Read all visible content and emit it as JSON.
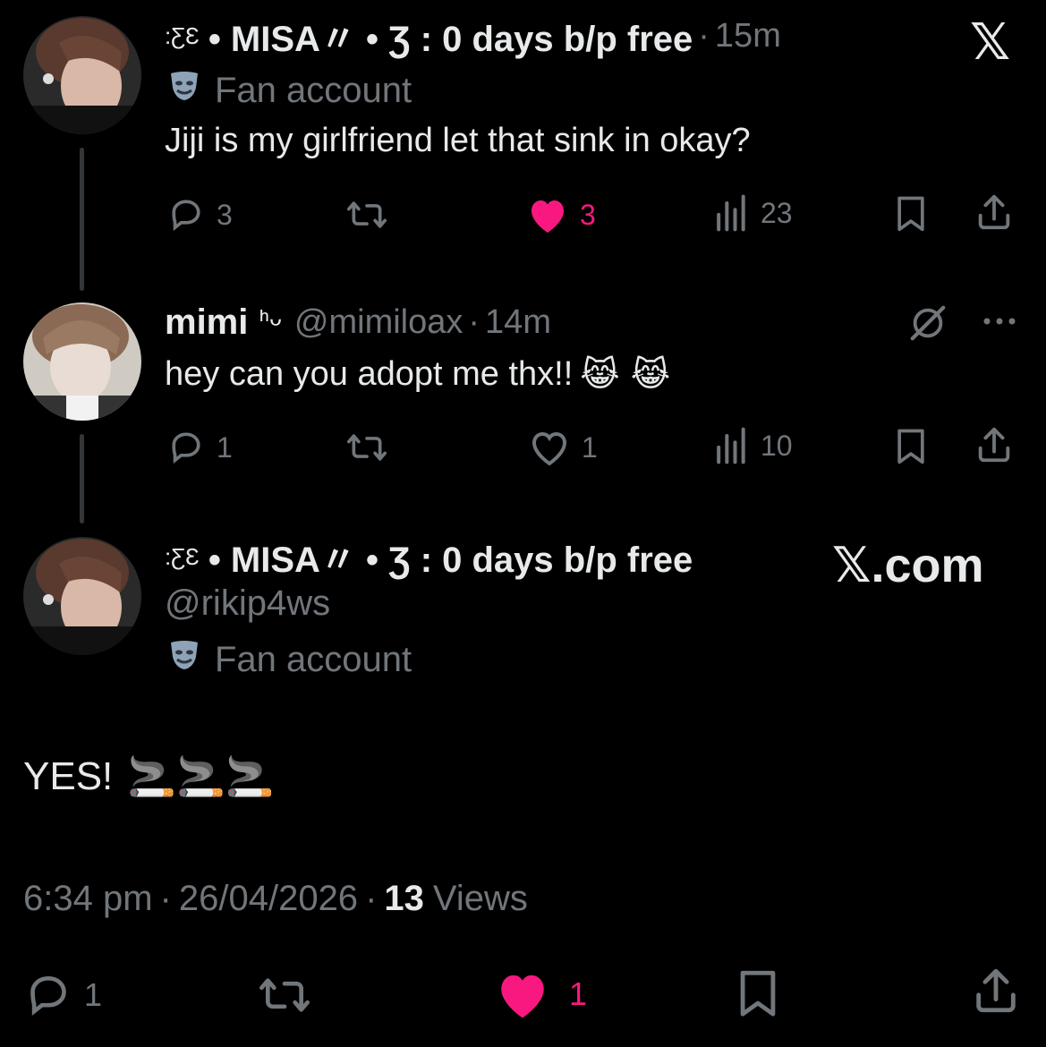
{
  "colors": {
    "background": "#000000",
    "text": "#e7e9ea",
    "muted": "#71767b",
    "like": "#f91880",
    "line": "#333639"
  },
  "tweet1": {
    "name_prefix": ":ƸƐ",
    "name": "• MISA〃 • Ʒ : 0 days b/p free",
    "sep": "·",
    "time": "15m",
    "badge_icon": "mask-icon",
    "badge": "Fan account",
    "body": "Jiji is my girlfriend let that sink in okay?",
    "replies": "3",
    "likes": "3",
    "views": "23"
  },
  "tweet2": {
    "name": "mimi",
    "name_suffix": "ᑋᵕ",
    "handle": "@mimiloax",
    "sep": "·",
    "time": "14m",
    "body": "hey can you adopt me thx!!",
    "body_emoji": "😹 😹",
    "replies": "1",
    "likes": "1",
    "views": "10"
  },
  "main": {
    "name_prefix": ":ƸƐ",
    "name": "• MISA〃 • Ʒ : 0 days b/p free",
    "handle": "@rikip4ws",
    "badge_icon": "mask-icon",
    "badge": "Fan account",
    "body": "YES!",
    "body_emoji": "🚬🚬🚬",
    "time": "6:34 pm",
    "sep1": "·",
    "date": "26/04/2026",
    "sep2": "·",
    "views_count": "13",
    "views_label": "Views",
    "replies": "1",
    "likes": "1"
  },
  "watermark": {
    "logo": "𝕏",
    "site": "𝕏.com"
  }
}
